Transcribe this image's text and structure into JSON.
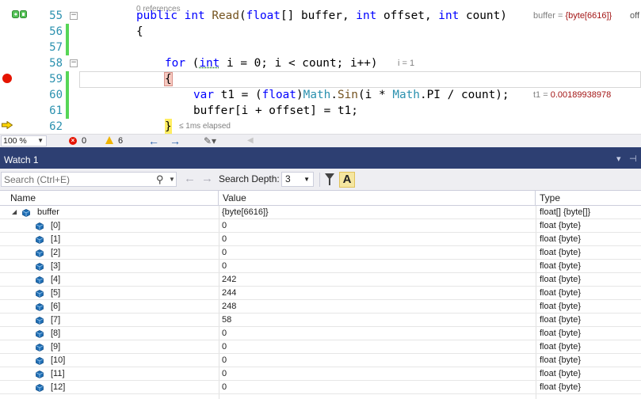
{
  "editor": {
    "code_lens": "0 references",
    "lines": [
      {
        "num": "55",
        "kind": "signature"
      },
      {
        "num": "56",
        "kind": "open_brace"
      },
      {
        "num": "57",
        "kind": "blank"
      },
      {
        "num": "58",
        "kind": "for"
      },
      {
        "num": "59",
        "kind": "open_brace_hl"
      },
      {
        "num": "60",
        "kind": "assign"
      },
      {
        "num": "61",
        "kind": "buffer_assign"
      },
      {
        "num": "62",
        "kind": "close_brace"
      }
    ],
    "code": {
      "kw_public": "public",
      "kw_int": "int",
      "read": "Read",
      "sig_open": "(",
      "kw_float": "float",
      "sig_arr": "[] buffer, ",
      "kw_int2": "int",
      "sig_offset": " offset, ",
      "kw_int3": "int",
      "sig_count": " count)",
      "open_brace": "{",
      "kw_for": "for",
      "for_open": " (",
      "kw_int_for": "int",
      "for_rest": " i = 0; i < count; i++)",
      "kw_var": "var",
      "assign_a": " t1 = (",
      "kw_float2": "float",
      "assign_b": ")",
      "math1": "Math",
      "dot1": ".",
      "sin": "Sin",
      "assign_c": "(i * ",
      "math2": "Math",
      "assign_d": ".PI / count);",
      "buffer_line": "buffer[i + offset] = t1;",
      "close_brace": "}"
    },
    "hints": {
      "buffer_label": "buffer = ",
      "buffer_value": "{byte[6616]}",
      "off_text": "off",
      "i_hint": "i = 1",
      "t1_label": "t1 = ",
      "t1_value": "0.00189938978",
      "elapsed": "≤ 1ms elapsed"
    },
    "status": {
      "zoom": "100 %",
      "errors": "0",
      "warnings": "6"
    }
  },
  "watch": {
    "title": "Watch 1",
    "search_placeholder": "Search (Ctrl+E)",
    "depth_label": "Search Depth:",
    "depth_value": "3",
    "hex_button": "A",
    "columns": {
      "name": "Name",
      "value": "Value",
      "type": "Type"
    },
    "rows": [
      {
        "name": "buffer",
        "value": "{byte[6616]}",
        "type": "float[] {byte[]}",
        "expanded": true,
        "child": false
      },
      {
        "name": "[0]",
        "value": "0",
        "type": "float {byte}",
        "child": true
      },
      {
        "name": "[1]",
        "value": "0",
        "type": "float {byte}",
        "child": true
      },
      {
        "name": "[2]",
        "value": "0",
        "type": "float {byte}",
        "child": true
      },
      {
        "name": "[3]",
        "value": "0",
        "type": "float {byte}",
        "child": true
      },
      {
        "name": "[4]",
        "value": "242",
        "type": "float {byte}",
        "child": true
      },
      {
        "name": "[5]",
        "value": "244",
        "type": "float {byte}",
        "child": true
      },
      {
        "name": "[6]",
        "value": "248",
        "type": "float {byte}",
        "child": true
      },
      {
        "name": "[7]",
        "value": "58",
        "type": "float {byte}",
        "child": true
      },
      {
        "name": "[8]",
        "value": "0",
        "type": "float {byte}",
        "child": true
      },
      {
        "name": "[9]",
        "value": "0",
        "type": "float {byte}",
        "child": true
      },
      {
        "name": "[10]",
        "value": "0",
        "type": "float {byte}",
        "child": true
      },
      {
        "name": "[11]",
        "value": "0",
        "type": "float {byte}",
        "child": true
      },
      {
        "name": "[12]",
        "value": "0",
        "type": "float {byte}",
        "child": true
      }
    ]
  },
  "colors": {
    "accent_title": "#2d3f72",
    "breakpoint": "#e51400",
    "keyword": "#0000ff",
    "type": "#2b91af",
    "change_bar": "#57d657"
  }
}
